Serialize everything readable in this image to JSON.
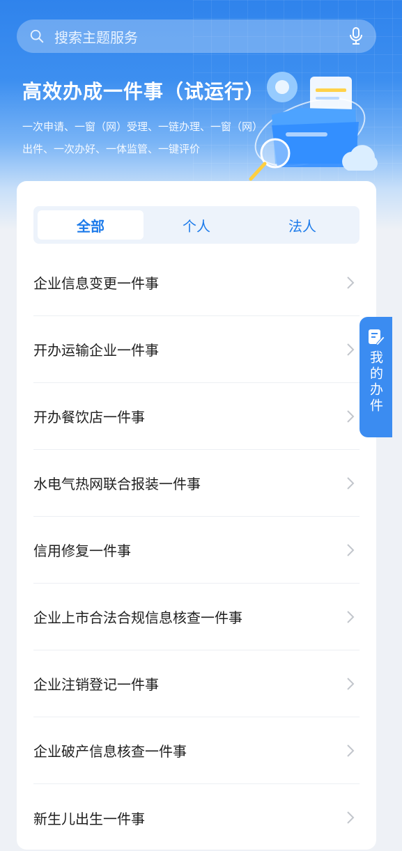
{
  "search": {
    "placeholder": "搜索主题服务",
    "search_icon": "search-icon",
    "mic_icon": "microphone-icon"
  },
  "hero": {
    "title": "高效办成一件事（试运行）",
    "subtitle": "一次申请、一窗（网）受理、一链办理、一窗（网）出件、一次办好、一体监管、一键评价"
  },
  "tabs": [
    {
      "label": "全部",
      "active": true
    },
    {
      "label": "个人",
      "active": false
    },
    {
      "label": "法人",
      "active": false
    }
  ],
  "items": [
    {
      "label": "企业信息变更一件事"
    },
    {
      "label": "开办运输企业一件事"
    },
    {
      "label": "开办餐饮店一件事"
    },
    {
      "label": "水电气热网联合报装一件事"
    },
    {
      "label": "信用修复一件事"
    },
    {
      "label": "企业上市合法合规信息核查一件事"
    },
    {
      "label": "企业注销登记一件事"
    },
    {
      "label": "企业破产信息核查一件事"
    },
    {
      "label": "新生儿出生一件事"
    }
  ],
  "side_tab": {
    "label": "我的办件",
    "icon": "edit-document-icon"
  },
  "colors": {
    "primary": "#1d7bea",
    "hero_top": "#2f83ec",
    "side_tab": "#3b8cf1",
    "page_bg": "#eef1f6"
  }
}
